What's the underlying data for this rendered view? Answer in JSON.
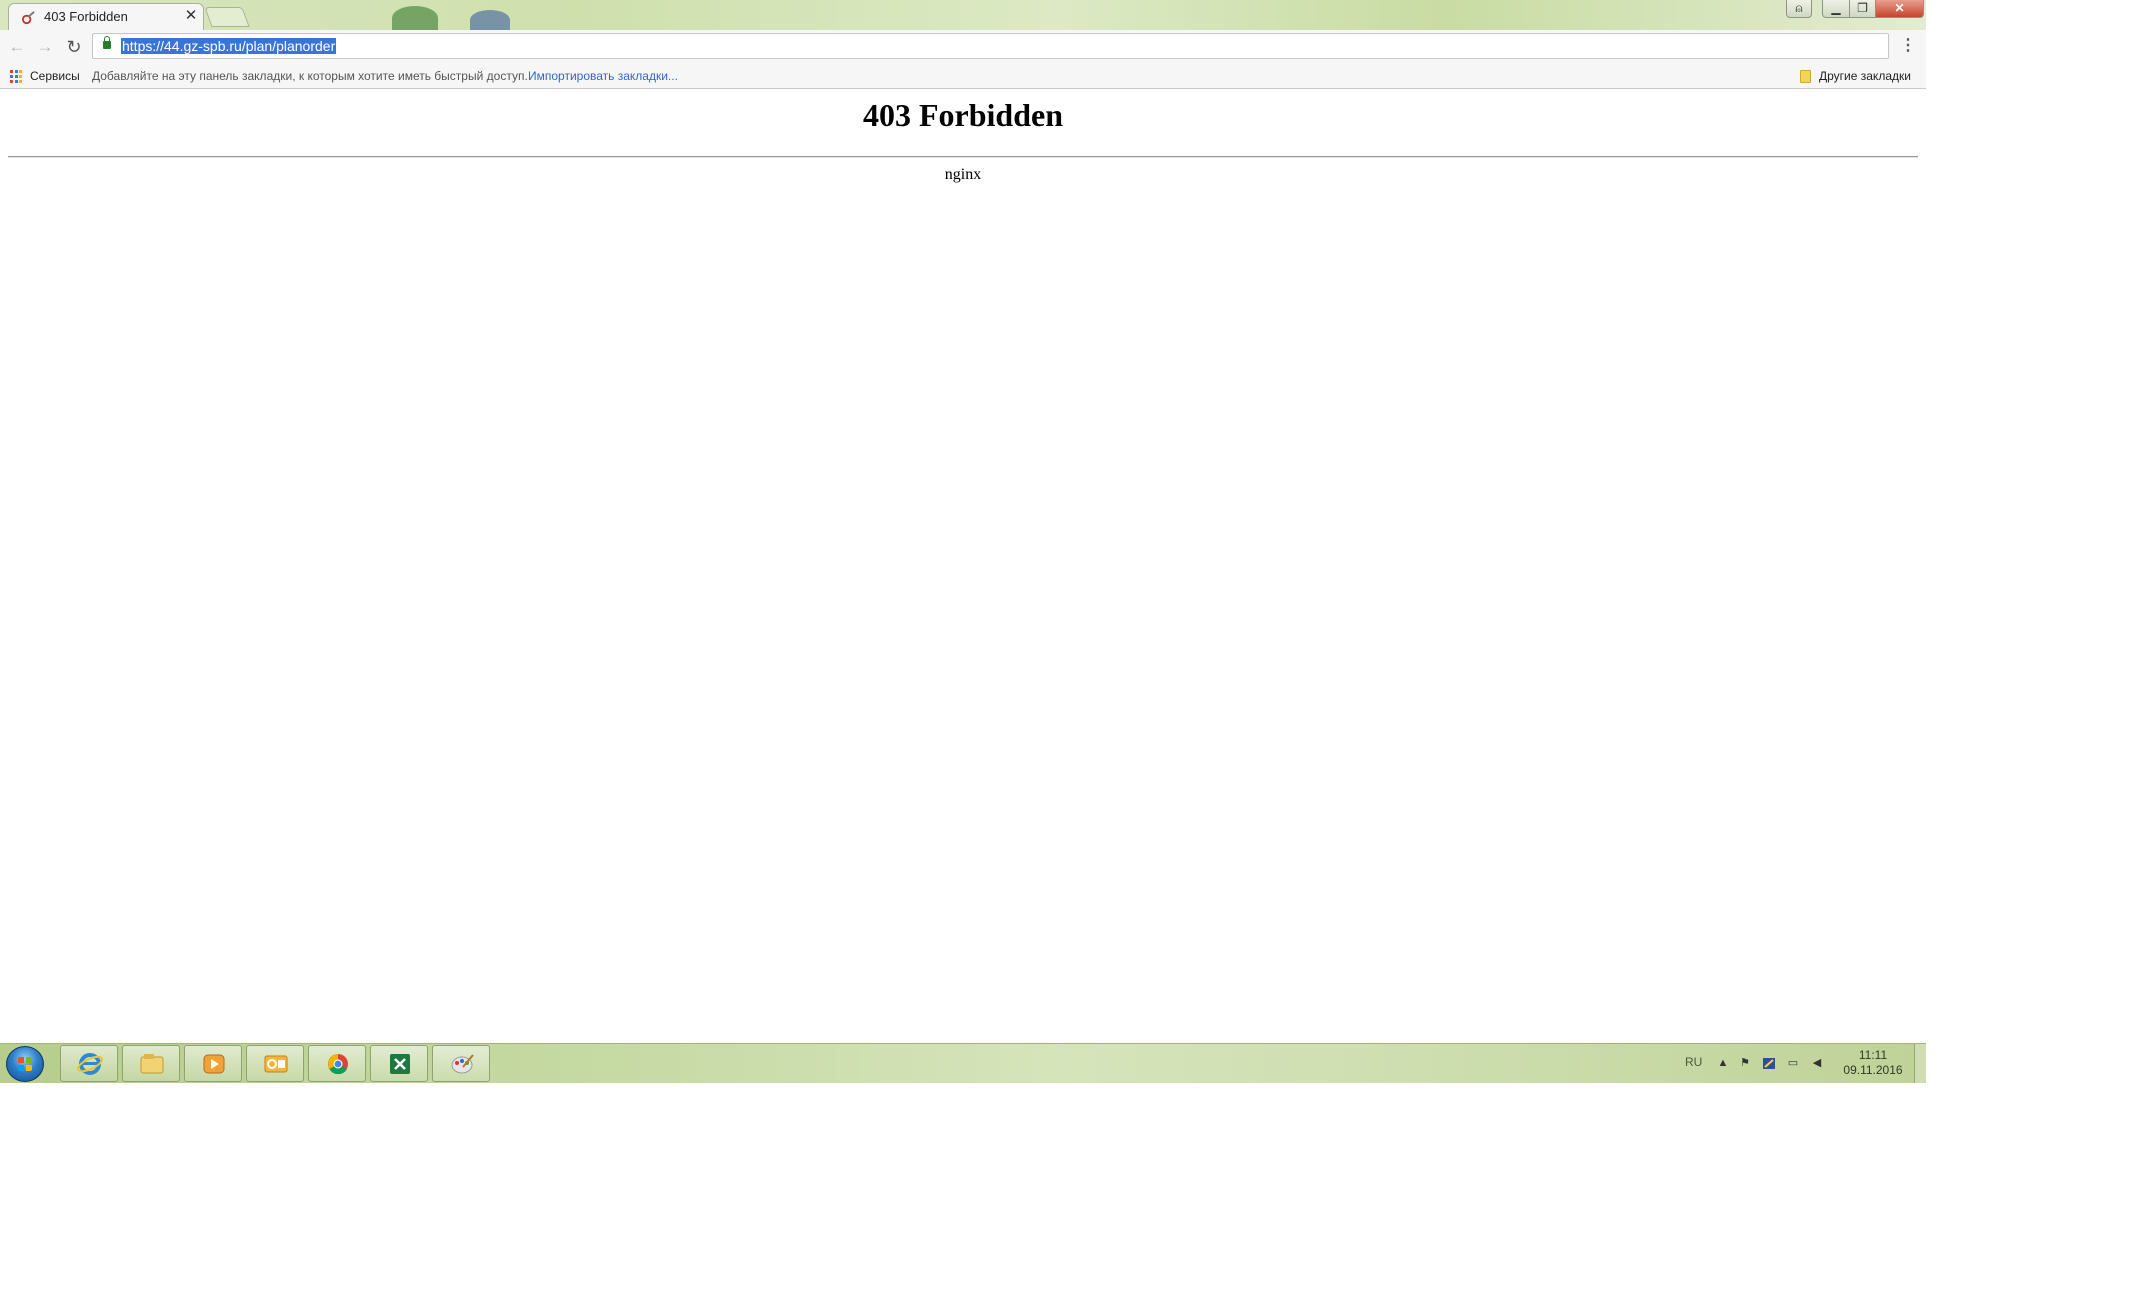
{
  "browser": {
    "tab": {
      "title": "403 Forbidden",
      "close_glyph": "✕"
    },
    "window_controls": {
      "user_glyph": "⍝",
      "minimize_glyph": "▁",
      "maximize_glyph": "❐",
      "close_glyph": "✕"
    },
    "toolbar": {
      "back_glyph": "←",
      "forward_glyph": "→",
      "reload_glyph": "↻",
      "url": "https://44.gz-spb.ru/plan/planorder",
      "star_glyph": "☆",
      "menu_glyph": "⋮"
    },
    "bookmarks": {
      "apps_label": "Сервисы",
      "hint": "Добавляйте на эту панель закладки, к которым хотите иметь быстрый доступ.",
      "import_link": "Импортировать закладки...",
      "other_label": "Другие закладки"
    }
  },
  "page": {
    "title": "403 Forbidden",
    "server": "nginx"
  },
  "taskbar": {
    "apps": [
      "internet-explorer",
      "file-explorer",
      "media-player",
      "outlook",
      "chrome",
      "excel",
      "paint"
    ],
    "tray": {
      "lang": "RU",
      "up_glyph": "▲",
      "flag_glyph": "⚑",
      "net_glyph": "▭",
      "volume_glyph": "◀",
      "time": "11:11",
      "date": "09.11.2016"
    }
  },
  "colors": {
    "url_selection": "#3875d7",
    "link": "#3366cc",
    "lock": "#2a7d2a"
  }
}
